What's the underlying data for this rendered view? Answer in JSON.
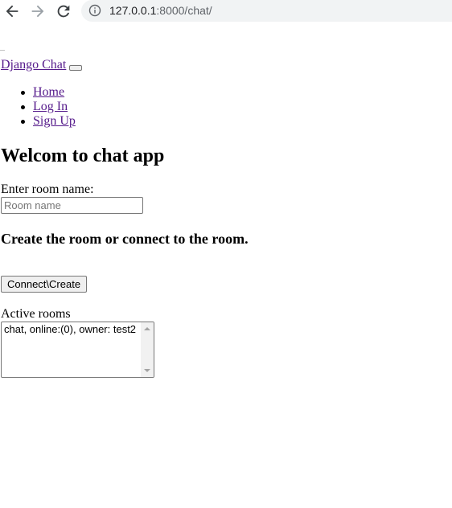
{
  "browser": {
    "url_host": "127.0.0.1",
    "url_rest": ":8000/chat/"
  },
  "navbar": {
    "brand": "Django Chat",
    "items": [
      {
        "label": "Home"
      },
      {
        "label": "Log In"
      },
      {
        "label": "Sign Up"
      }
    ]
  },
  "main": {
    "title": "Welcom to chat app",
    "room_label": "Enter room name:",
    "room_input": {
      "placeholder": "Room name",
      "value": ""
    },
    "subtitle": "Create the room or connect to the room.",
    "connect_button": "Connect\\Create",
    "active_rooms_label": "Active rooms",
    "active_rooms": [
      "chat, online:(0), owner: test2"
    ]
  }
}
